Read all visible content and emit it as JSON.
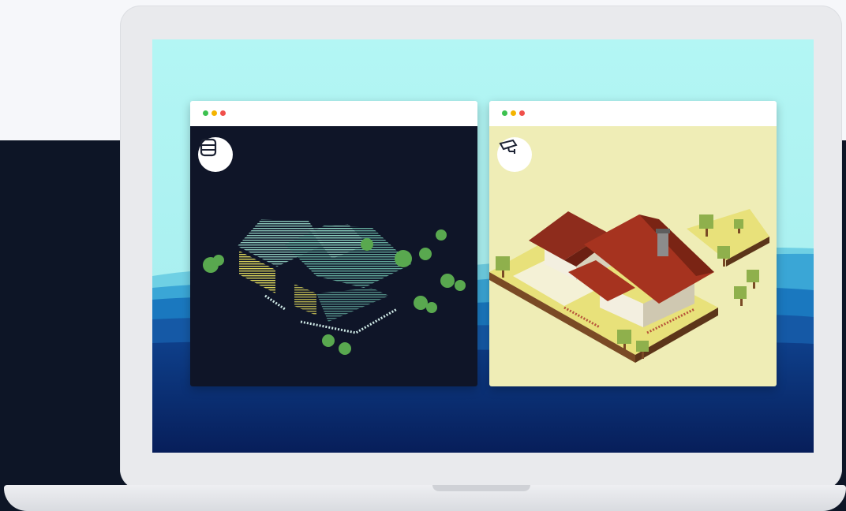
{
  "windows": [
    {
      "id": "point-cloud",
      "icon": "server-stack-icon",
      "dots": [
        "#3cc14f",
        "#f4b400",
        "#f0504b"
      ],
      "background": "#0f1528"
    },
    {
      "id": "cctv-model",
      "icon": "security-camera-icon",
      "dots": [
        "#3cc14f",
        "#f4b400",
        "#f0504b"
      ],
      "background": "#efedb6"
    }
  ],
  "colors": {
    "sky": "#aef3f1",
    "ocean_light": "#2f9fd0",
    "ocean_deep": "#0a2a6a",
    "lid": "#e9eaed",
    "dark_band": "#0d1526"
  }
}
